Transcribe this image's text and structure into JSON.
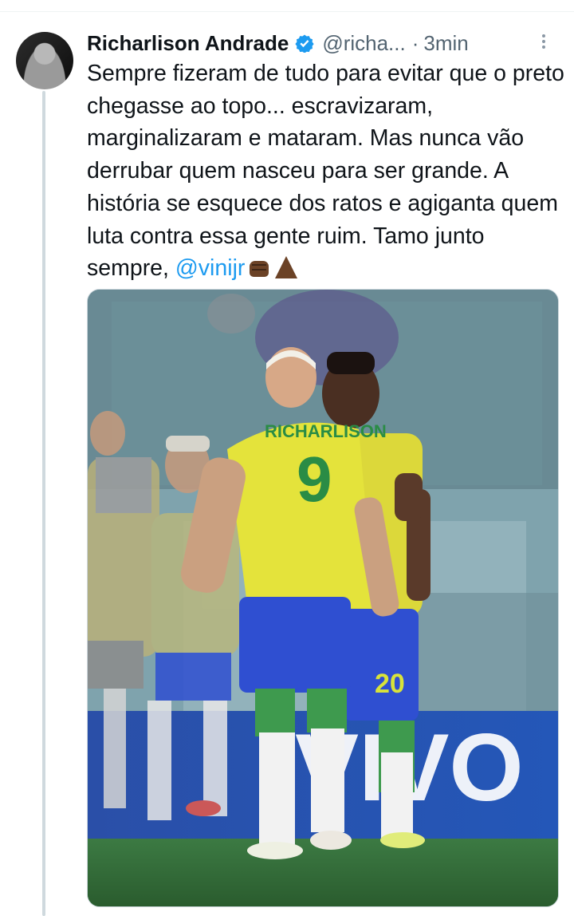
{
  "tweet": {
    "author_name": "Richarlison Andrade",
    "handle": "@richa...",
    "separator": "·",
    "time": "3min",
    "text_main": "Sempre fizeram de tudo para evitar que o preto chegasse ao topo... escravizaram, marginalizaram e mataram. Mas nunca vão derrubar quem nasceu para ser grande. A história se esquece dos ratos e agiganta quem luta contra essa gente ruim. Tamo junto sempre, ",
    "mention": "@vinijr",
    "emojis": [
      "fist-icon",
      "pray-icon"
    ]
  },
  "photo": {
    "jersey_name": "RICHARLISON",
    "jersey_number_back": "9",
    "shorts_number": "20",
    "board_text": "VIVO"
  },
  "colors": {
    "verified_blue": "#1d9bf0",
    "mention_blue": "#1d9bf0",
    "secondary_text": "#536471",
    "jersey_yellow": "#e4e33b",
    "shorts_blue": "#2f4fd1",
    "pitch_green": "#2f6d3a"
  }
}
